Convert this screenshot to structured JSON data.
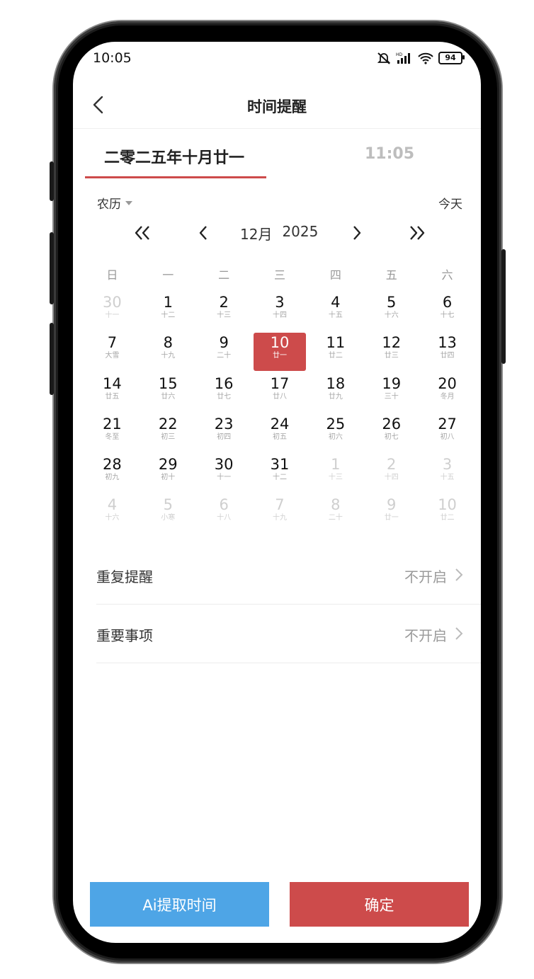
{
  "status": {
    "time": "10:05",
    "battery": "94"
  },
  "header": {
    "title": "时间提醒"
  },
  "tabs": {
    "date": "二零二五年十月廿一",
    "time": "11:05"
  },
  "toolbar": {
    "calendar_type": "农历",
    "today": "今天"
  },
  "month_nav": {
    "month": "12月",
    "year": "2025"
  },
  "weekdays": [
    "日",
    "一",
    "二",
    "三",
    "四",
    "五",
    "六"
  ],
  "days": [
    {
      "n": "30",
      "l": "十一",
      "other": true
    },
    {
      "n": "1",
      "l": "十二"
    },
    {
      "n": "2",
      "l": "十三"
    },
    {
      "n": "3",
      "l": "十四"
    },
    {
      "n": "4",
      "l": "十五"
    },
    {
      "n": "5",
      "l": "十六"
    },
    {
      "n": "6",
      "l": "十七"
    },
    {
      "n": "7",
      "l": "大雪"
    },
    {
      "n": "8",
      "l": "十九"
    },
    {
      "n": "9",
      "l": "二十"
    },
    {
      "n": "10",
      "l": "廿一",
      "selected": true
    },
    {
      "n": "11",
      "l": "廿二"
    },
    {
      "n": "12",
      "l": "廿三"
    },
    {
      "n": "13",
      "l": "廿四"
    },
    {
      "n": "14",
      "l": "廿五"
    },
    {
      "n": "15",
      "l": "廿六"
    },
    {
      "n": "16",
      "l": "廿七"
    },
    {
      "n": "17",
      "l": "廿八"
    },
    {
      "n": "18",
      "l": "廿九"
    },
    {
      "n": "19",
      "l": "三十"
    },
    {
      "n": "20",
      "l": "冬月"
    },
    {
      "n": "21",
      "l": "冬至"
    },
    {
      "n": "22",
      "l": "初三"
    },
    {
      "n": "23",
      "l": "初四"
    },
    {
      "n": "24",
      "l": "初五"
    },
    {
      "n": "25",
      "l": "初六"
    },
    {
      "n": "26",
      "l": "初七"
    },
    {
      "n": "27",
      "l": "初八"
    },
    {
      "n": "28",
      "l": "初九"
    },
    {
      "n": "29",
      "l": "初十"
    },
    {
      "n": "30",
      "l": "十一"
    },
    {
      "n": "31",
      "l": "十二"
    },
    {
      "n": "1",
      "l": "十三",
      "other": true
    },
    {
      "n": "2",
      "l": "十四",
      "other": true
    },
    {
      "n": "3",
      "l": "十五",
      "other": true
    },
    {
      "n": "4",
      "l": "十六",
      "other": true
    },
    {
      "n": "5",
      "l": "小寒",
      "other": true
    },
    {
      "n": "6",
      "l": "十八",
      "other": true
    },
    {
      "n": "7",
      "l": "十九",
      "other": true
    },
    {
      "n": "8",
      "l": "二十",
      "other": true
    },
    {
      "n": "9",
      "l": "廿一",
      "other": true
    },
    {
      "n": "10",
      "l": "廿二",
      "other": true
    }
  ],
  "settings": {
    "repeat": {
      "label": "重复提醒",
      "value": "不开启"
    },
    "important": {
      "label": "重要事项",
      "value": "不开启"
    }
  },
  "buttons": {
    "ai": "Ai提取时间",
    "confirm": "确定"
  },
  "colors": {
    "accent": "#cd4b4b",
    "ai_button": "#4ea5e6"
  }
}
